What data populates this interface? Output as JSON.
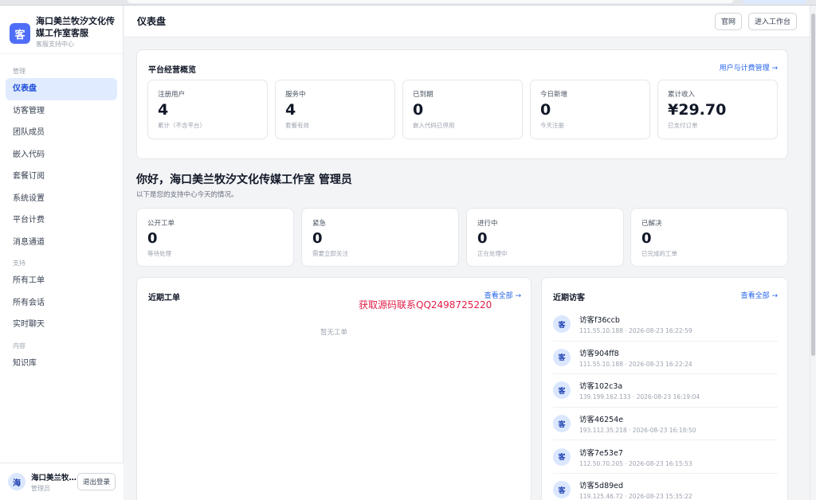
{
  "brand": {
    "logo_char": "客",
    "name": "海口美兰牧汐文化传媒工作室客服",
    "subtitle": "客服支持中心"
  },
  "sidebar": {
    "sections": [
      {
        "label": "管理",
        "items": [
          {
            "label": "仪表盘",
            "active": true
          },
          {
            "label": "访客管理"
          },
          {
            "label": "团队成员"
          },
          {
            "label": "嵌入代码"
          },
          {
            "label": "套餐订阅"
          },
          {
            "label": "系统设置"
          },
          {
            "label": "平台计费"
          },
          {
            "label": "消息通道"
          }
        ]
      },
      {
        "label": "支持",
        "items": [
          {
            "label": "所有工单"
          },
          {
            "label": "所有会话"
          },
          {
            "label": "实时聊天"
          }
        ]
      },
      {
        "label": "内容",
        "items": [
          {
            "label": "知识库"
          }
        ]
      }
    ],
    "user": {
      "avatar_char": "海",
      "name": "海口美兰牧...",
      "role": "管理员",
      "logout_label": "退出登录"
    }
  },
  "header": {
    "title": "仪表盘",
    "official_site_label": "官网",
    "workspace_label": "进入工作台"
  },
  "overview": {
    "title": "平台经营概览",
    "link": "用户与计费管理 →",
    "stats": [
      {
        "label": "注册用户",
        "value": "4",
        "desc": "累计（不含平台）"
      },
      {
        "label": "服务中",
        "value": "4",
        "desc": "套餐有效"
      },
      {
        "label": "已到期",
        "value": "0",
        "desc": "嵌入代码已停用"
      },
      {
        "label": "今日新增",
        "value": "0",
        "desc": "今天注册"
      },
      {
        "label": "累计收入",
        "value": "¥29.70",
        "desc": "已支付订单"
      }
    ]
  },
  "greeting": {
    "title": "你好，海口美兰牧汐文化传媒工作室 管理员",
    "subtitle": "以下是您的支持中心今天的情况。"
  },
  "ticket_stats": [
    {
      "label": "公开工单",
      "value": "0",
      "desc": "等待处理"
    },
    {
      "label": "紧急",
      "value": "0",
      "desc": "需要立即关注"
    },
    {
      "label": "进行中",
      "value": "0",
      "desc": "正在处理中"
    },
    {
      "label": "已解决",
      "value": "0",
      "desc": "已完成的工单"
    }
  ],
  "recent_tickets": {
    "title": "近期工单",
    "link": "查看全部 →",
    "empty": "暂无工单"
  },
  "recent_visitors": {
    "title": "近期访客",
    "link": "查看全部 →",
    "avatar_char": "客",
    "items": [
      {
        "name": "访客f36ccb",
        "meta": "111.55.10.188 · 2026-08-23 16:22:59"
      },
      {
        "name": "访客904ff8",
        "meta": "111.55.10.188 · 2026-08-23 16:22:24"
      },
      {
        "name": "访客102c3a",
        "meta": "139.199.162.133 · 2026-08-23 16:19:04"
      },
      {
        "name": "访客46254e",
        "meta": "193.112.35.218 · 2026-08-23 16:18:50"
      },
      {
        "name": "访客7e53e7",
        "meta": "112.50.70.205 · 2026-08-23 16:15:53"
      },
      {
        "name": "访客5d89ed",
        "meta": "119.125.46.72 · 2026-08-23 15:35:22"
      }
    ]
  },
  "watermark": "获取源码联系QQ2498725220",
  "colors": {
    "accent": "#2563eb",
    "active_bg": "#e0ebff",
    "logo_bg": "#4f6ef7",
    "watermark": "#e11d48"
  }
}
